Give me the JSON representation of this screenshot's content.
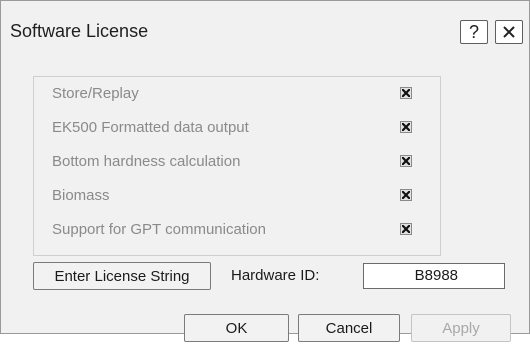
{
  "window": {
    "title": "Software License",
    "help_label": "?"
  },
  "features": [
    {
      "label": "Store/Replay",
      "checked": true
    },
    {
      "label": "EK500 Formatted data output",
      "checked": true
    },
    {
      "label": "Bottom hardness calculation",
      "checked": true
    },
    {
      "label": "Biomass",
      "checked": true
    },
    {
      "label": "Support for GPT communication",
      "checked": true
    }
  ],
  "license": {
    "enter_button_label": "Enter License String",
    "hardware_id_label": "Hardware ID:",
    "hardware_id_value": "B8988"
  },
  "buttons": {
    "ok_label": "OK",
    "cancel_label": "Cancel",
    "apply_label": "Apply"
  },
  "icons": {
    "close": "close-icon",
    "checkbox": "checkbox-checked-icon"
  },
  "colors": {
    "dialog_background": "#f1f1f1",
    "feature_text_disabled": "#8a8a8a",
    "apply_text_disabled": "#a8a8a8"
  }
}
